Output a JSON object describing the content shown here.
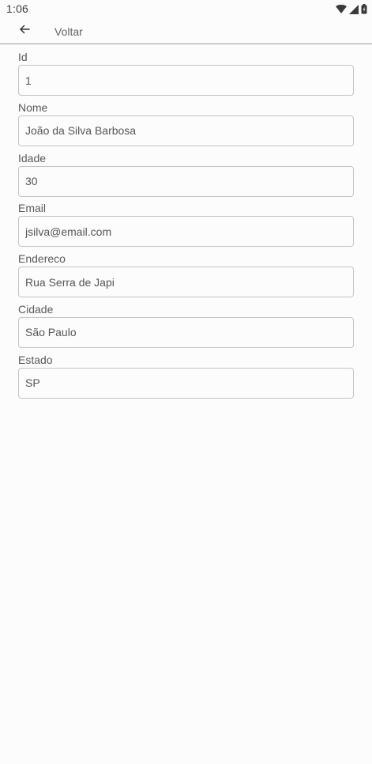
{
  "status_bar": {
    "time": "1:06",
    "icons": [
      "wifi-icon",
      "signal-icon",
      "battery-icon"
    ]
  },
  "app_bar": {
    "back_icon": "arrow-left-icon",
    "title": "Voltar"
  },
  "form": {
    "fields": [
      {
        "key": "id",
        "label": "Id",
        "value": "1"
      },
      {
        "key": "nome",
        "label": "Nome",
        "value": "João da Silva Barbosa"
      },
      {
        "key": "idade",
        "label": "Idade",
        "value": "30"
      },
      {
        "key": "email",
        "label": "Email",
        "value": "jsilva@email.com"
      },
      {
        "key": "endereco",
        "label": "Endereco",
        "value": "Rua Serra de Japi"
      },
      {
        "key": "cidade",
        "label": "Cidade",
        "value": "São Paulo"
      },
      {
        "key": "estado",
        "label": "Estado",
        "value": "SP"
      }
    ]
  },
  "colors": {
    "background": "#fcfcfc",
    "border": "#c4c4c4",
    "text": "#555555"
  }
}
